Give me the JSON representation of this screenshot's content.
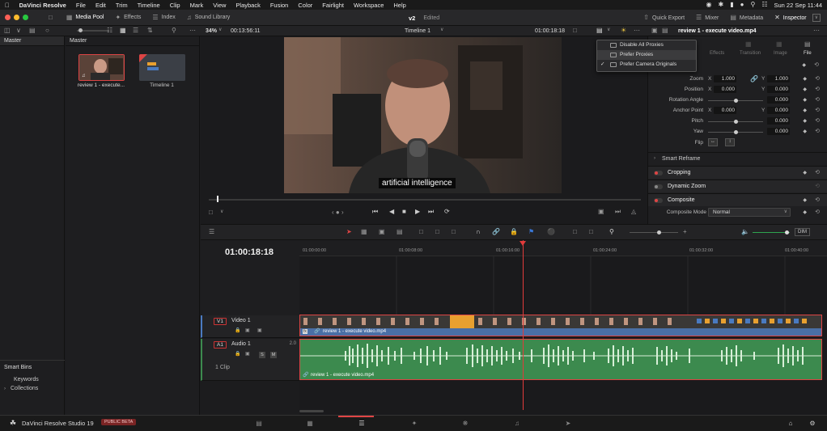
{
  "menubar": {
    "app": "DaVinci Resolve",
    "items": [
      "File",
      "Edit",
      "Trim",
      "Timeline",
      "Clip",
      "Mark",
      "View",
      "Playback",
      "Fusion",
      "Color",
      "Fairlight",
      "Workspace",
      "Help"
    ],
    "datetime": "Sun 22 Sep 11:44"
  },
  "toolbar": {
    "media_pool": "Media Pool",
    "effects": "Effects",
    "index": "Index",
    "sound_library": "Sound Library",
    "project_name": "v2",
    "project_status": "Edited",
    "quick_export": "Quick Export",
    "mixer": "Mixer",
    "metadata": "Metadata",
    "inspector": "Inspector"
  },
  "subbar": {
    "zoom": "34%",
    "duration": "00:13:56:11",
    "timeline_name": "Timeline 1",
    "timecode": "01:00:18:18",
    "clip_name": "review 1 - execute video.mp4"
  },
  "bins": {
    "master_label": "Master",
    "smart_bins": "Smart Bins",
    "keywords": "Keywords",
    "collections": "Collections"
  },
  "pool": {
    "header": "Master",
    "clips": [
      {
        "name": "review 1 - execute..."
      },
      {
        "name": "Timeline 1"
      }
    ]
  },
  "viewer": {
    "subtitle": "artificial intelligence"
  },
  "proxy_menu": {
    "items": [
      {
        "label": "Disable All Proxies",
        "checked": false
      },
      {
        "label": "Prefer Proxies",
        "checked": false
      },
      {
        "label": "Prefer Camera Originals",
        "checked": true
      }
    ]
  },
  "inspector": {
    "tabs": [
      "Effects",
      "Transition",
      "Image",
      "File"
    ],
    "zoom_label": "Zoom",
    "zoom_x": "1.000",
    "zoom_y": "1.000",
    "position_label": "Position",
    "position_x": "0.000",
    "position_y": "0.000",
    "rotation_label": "Rotation Angle",
    "rotation": "0.000",
    "anchor_label": "Anchor Point",
    "anchor_x": "0.000",
    "anchor_y": "0.000",
    "pitch_label": "Pitch",
    "pitch": "0.000",
    "yaw_label": "Yaw",
    "yaw": "0.000",
    "flip_label": "Flip",
    "axis_x": "X",
    "axis_y": "Y",
    "smart_reframe": "Smart Reframe",
    "cropping": "Cropping",
    "dynamic_zoom": "Dynamic Zoom",
    "composite": "Composite",
    "composite_mode_label": "Composite Mode",
    "composite_mode": "Normal"
  },
  "timeline": {
    "timecode": "01:00:18:18",
    "dim": "DIM",
    "ruler": [
      "01:00:00:00",
      "01:00:08:00",
      "01:00:16:00",
      "01:00:24:00",
      "01:00:32:00",
      "01:00:40:00"
    ],
    "video_track": {
      "id": "V1",
      "name": "Video 1",
      "clip": "review 1 - execute video.mp4"
    },
    "audio_track": {
      "id": "A1",
      "name": "Audio 1",
      "level": "2.0",
      "clips": "1 Clip",
      "clip": "review 1 - execute video.mp4",
      "s": "S",
      "m": "M"
    }
  },
  "bottombar": {
    "product": "DaVinci Resolve Studio 19",
    "badge": "PUBLIC BETA"
  },
  "colors": {
    "accent_red": "#e04545",
    "video_clip": "#4a6fa5",
    "audio_clip": "#3c8a4e",
    "playhead": "#e23b3b"
  }
}
